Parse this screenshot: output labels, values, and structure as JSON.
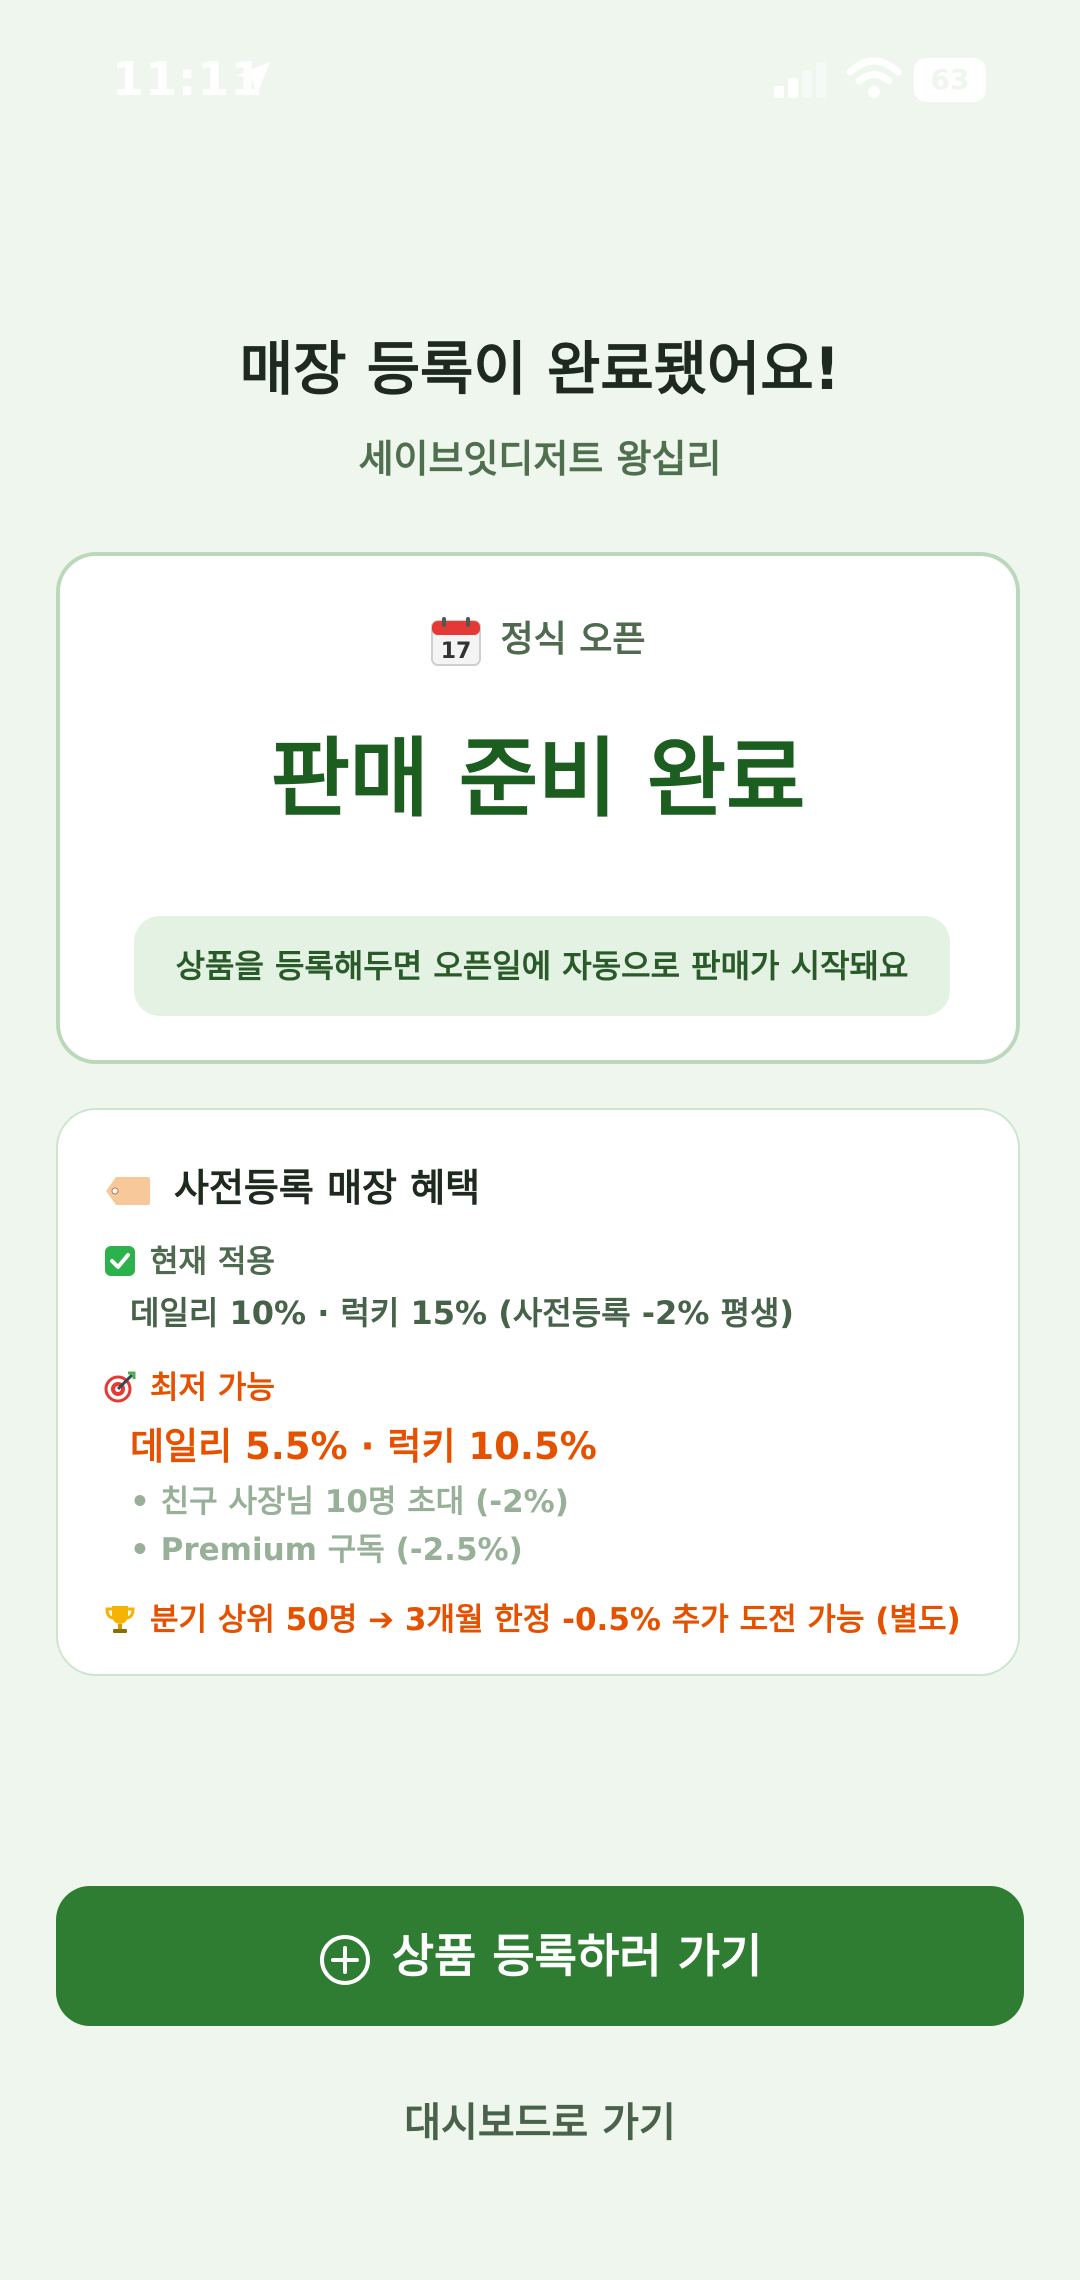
{
  "status_bar": {
    "time": "11:11",
    "battery": "63",
    "icons": [
      "location-arrow-icon",
      "cellular-signal-icon",
      "wifi-icon",
      "battery-icon"
    ]
  },
  "header": {
    "title": "매장 등록이 완료됐어요!",
    "store_name": "세이브잇디저트 왕십리"
  },
  "status_card": {
    "icon": "calendar-icon",
    "label": "정식 오픈",
    "status": "판매 준비 완료",
    "notice": "상품을 등록해두면 오픈일에 자동으로 판매가 시작돼요"
  },
  "benefits_card": {
    "icon": "price-tag-icon",
    "title": "사전등록 매장 혜택",
    "applied": {
      "icon": "check-mark-icon",
      "label": "현재 적용",
      "value": "데일리 10% · 럭키 15% (사전등록 -2% 평생)"
    },
    "best": {
      "icon": "target-icon",
      "label": "최저 가능",
      "value": "데일리 5.5% · 럭키 10.5%",
      "bullets": [
        "• 친구 사장님 10명 초대 (-2%)",
        "• Premium 구독 (-2.5%)"
      ]
    },
    "bonus": {
      "icon": "trophy-icon",
      "text": "분기 상위 50명 ➔ 3개월 한정 -0.5% 추가 도전 가능 (별도)"
    }
  },
  "actions": {
    "primary_icon": "plus-circle-icon",
    "primary_label": "상품 등록하러 가기",
    "secondary_label": "대시보드로 가기"
  },
  "colors": {
    "background": "#eef6ee",
    "primary_green": "#2e7d32",
    "status_green": "#1b5e20",
    "accent_orange": "#e65100",
    "card_border": "#bcd8bc"
  }
}
